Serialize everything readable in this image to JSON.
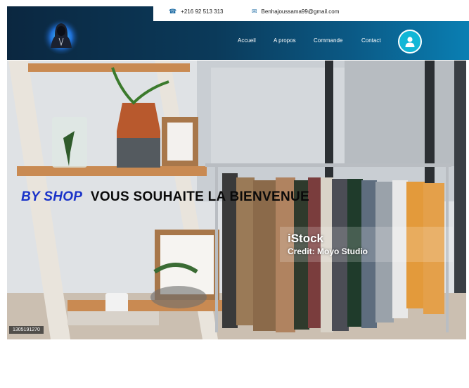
{
  "header": {
    "phone": "+216 92 513 313",
    "email": "Benhajoussama99@gmail.com",
    "nav": [
      {
        "label": "Accueil"
      },
      {
        "label": "A propos"
      },
      {
        "label": "Commande"
      },
      {
        "label": "Contact"
      }
    ]
  },
  "hero": {
    "welcome_brand": "BY SHOP",
    "welcome_text": "VOUS SOUHAITE LA BIENVENUE",
    "watermark_brand": "iStock",
    "watermark_credit": "Credit: Moyo Studio",
    "image_id": "1305191270"
  },
  "colors": {
    "header_dark": "#0b2740",
    "header_light": "#0a7fb3",
    "accent": "#12b6d6",
    "brand_blue": "#1a33c9"
  },
  "icons": {
    "phone": "phone-icon",
    "email": "mail-icon",
    "user": "user-icon",
    "logo": "hoodie-logo"
  }
}
